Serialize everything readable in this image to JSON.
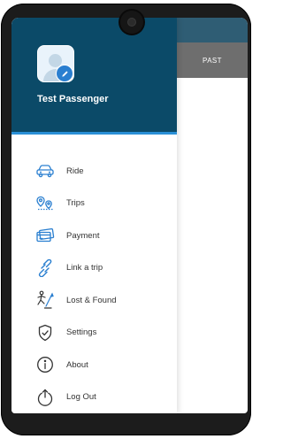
{
  "user": {
    "name": "Test Passenger"
  },
  "background_app": {
    "tab_label": "PAST"
  },
  "menu": {
    "items": [
      {
        "label": "Ride",
        "icon": "car-icon"
      },
      {
        "label": "Trips",
        "icon": "map-pins-icon"
      },
      {
        "label": "Payment",
        "icon": "credit-card-icon"
      },
      {
        "label": "Link a trip",
        "icon": "link-icon"
      },
      {
        "label": "Lost & Found",
        "icon": "search-person-icon"
      },
      {
        "label": "Settings",
        "icon": "shield-check-icon"
      },
      {
        "label": "About",
        "icon": "info-icon"
      },
      {
        "label": "Log Out",
        "icon": "logout-icon"
      }
    ]
  },
  "colors": {
    "header_bg": "#0b4a68",
    "accent": "#2a8fd6",
    "icon_blue": "#2a7fd0",
    "tab_bg": "#6e6e6e"
  }
}
